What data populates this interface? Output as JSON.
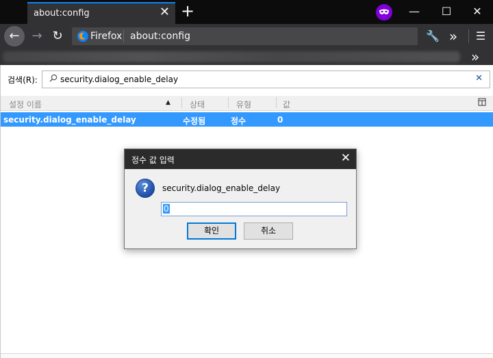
{
  "tab": {
    "title": "about:config",
    "close": "✕",
    "new_tab": "+"
  },
  "window": {
    "minimize": "—",
    "maximize": "☐",
    "close": "✕"
  },
  "navbar": {
    "back": "←",
    "forward": "→",
    "reload": "↻",
    "browser_label": "Firefox",
    "url": "about:config",
    "tools": "🔧",
    "overflow": "»",
    "menu": "☰"
  },
  "bookmarks": {
    "overflow": "»"
  },
  "config": {
    "search_label": "검색(R):",
    "search_value": "security.dialog_enable_delay",
    "search_clear": "✕",
    "columns": [
      "설정 이름",
      "상태",
      "유형",
      "값"
    ],
    "sort_indicator": "▲",
    "row": {
      "name": "security.dialog_enable_delay",
      "status": "수정됨",
      "type": "정수",
      "value": "0"
    }
  },
  "dialog": {
    "title": "정수 값 입력",
    "close": "✕",
    "icon": "?",
    "message": "security.dialog_enable_delay",
    "input_value": "0",
    "ok_label": "확인",
    "cancel_label": "취소"
  },
  "colors": {
    "accent": "#0a84ff",
    "selection": "#3399ff",
    "private_badge": "#8000d7"
  }
}
